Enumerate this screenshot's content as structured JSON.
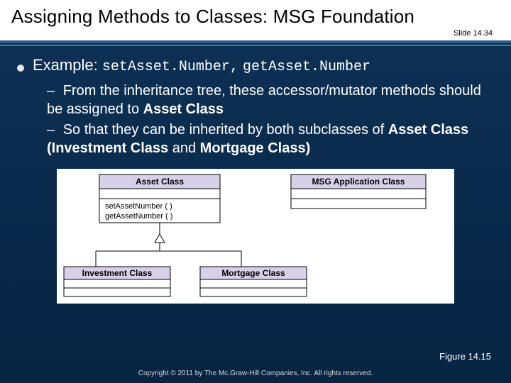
{
  "header": {
    "title": "Assigning Methods to Classes: MSG Foundation",
    "slide_number": "Slide 14.34"
  },
  "bullet": {
    "label": "Example:",
    "code1": "setAsset.Number,",
    "code2": "getAsset.Number"
  },
  "sub_bullets": {
    "line1_a": "From the inheritance tree, these accessor/mutator methods should be assigned to ",
    "line1_b": "Asset Class",
    "line2_a": "So that they can be inherited by both subclasses of ",
    "line2_b": "Asset Class (Investment Class",
    "line2_c": " and ",
    "line2_d": "Mortgage Class)"
  },
  "diagram": {
    "asset_class": "Asset Class",
    "msg_app_class": "MSG Application Class",
    "method1": "setAssetNumber ( )",
    "method2": "getAssetNumber ( )",
    "investment_class": "Investment Class",
    "mortgage_class": "Mortgage Class"
  },
  "figure_label": "Figure 14.15",
  "copyright": "Copyright © 2011 by The Mc.Graw-Hill Companies, Inc. All rights reserved."
}
